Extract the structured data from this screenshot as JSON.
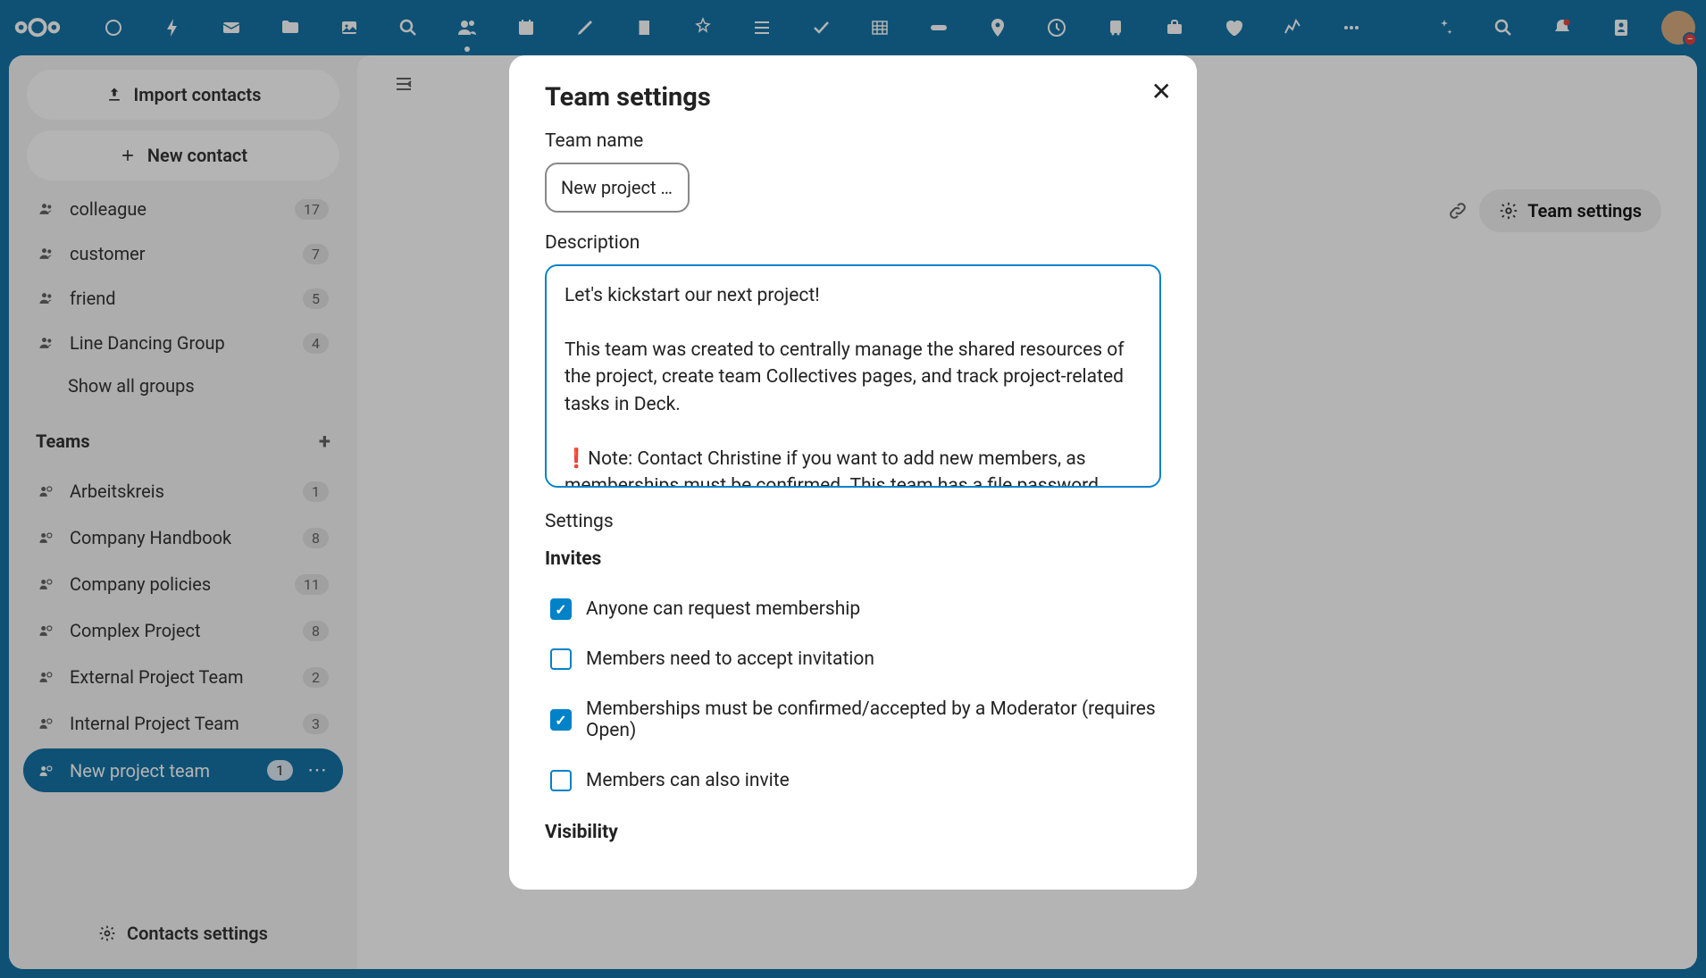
{
  "sidebar": {
    "import_label": "Import contacts",
    "new_contact_label": "New contact",
    "show_all_label": "Show all groups",
    "groups": [
      {
        "label": "colleague",
        "count": "17"
      },
      {
        "label": "customer",
        "count": "7"
      },
      {
        "label": "friend",
        "count": "5"
      },
      {
        "label": "Line Dancing Group",
        "count": "4"
      }
    ],
    "teams_header": "Teams",
    "teams": [
      {
        "label": "Arbeitskreis",
        "count": "1"
      },
      {
        "label": "Company Handbook",
        "count": "8"
      },
      {
        "label": "Company policies",
        "count": "11"
      },
      {
        "label": "Complex Project",
        "count": "8"
      },
      {
        "label": "External Project Team",
        "count": "2"
      },
      {
        "label": "Internal Project Team",
        "count": "3"
      },
      {
        "label": "New project team",
        "count": "1"
      }
    ],
    "contacts_settings_label": "Contacts settings"
  },
  "content": {
    "team_settings_btn": "Team settings"
  },
  "modal": {
    "title": "Team settings",
    "team_name_label": "Team name",
    "team_name_value": "New project …",
    "description_label": "Description",
    "description_value": "Let's kickstart our next project!\n\nThis team was created to centrally manage the shared resources of the project, create team Collectives pages, and track project-related tasks in Deck.\n\n❗Note: Contact Christine if you want to add new members, as memberships must be confirmed. This team has a file password policy: all shared files must be encrypted. ",
    "settings_label": "Settings",
    "invites_label": "Invites",
    "checkboxes": [
      {
        "label": "Anyone can request membership",
        "checked": true
      },
      {
        "label": "Members need to accept invitation",
        "checked": false
      },
      {
        "label": "Memberships must be confirmed/accepted by a Moderator (requires Open)",
        "checked": true
      },
      {
        "label": "Members can also invite",
        "checked": false
      }
    ],
    "visibility_label": "Visibility"
  }
}
